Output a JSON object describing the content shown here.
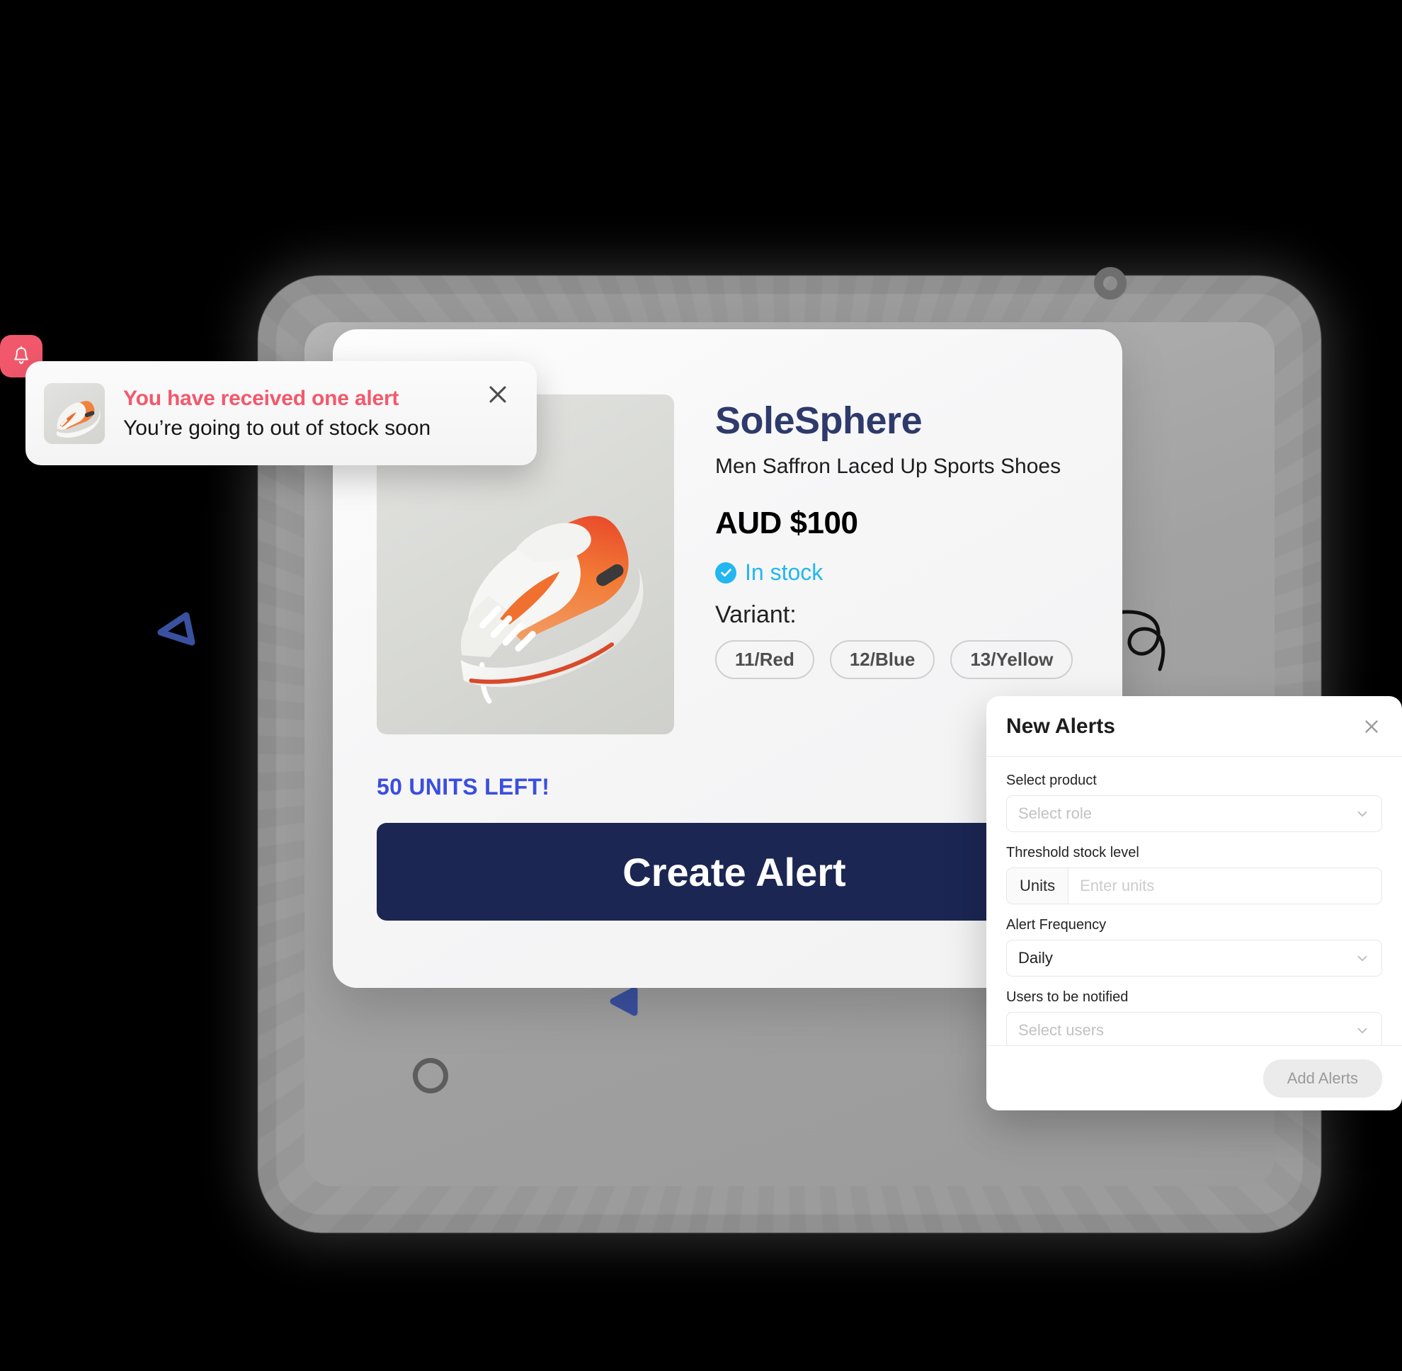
{
  "toast": {
    "bell_icon": "bell-icon",
    "title": "You have received one alert",
    "subtitle": "You’re going to out of stock soon",
    "close_icon": "close-icon",
    "thumb_icon": "product-thumbnail"
  },
  "product": {
    "brand": "SoleSphere",
    "subtitle": "Men Saffron Laced Up Sports Shoes",
    "price": "AUD $100",
    "stock_status": "In stock",
    "stock_icon": "check-circle-icon",
    "variant_label": "Variant:",
    "variants": [
      "11/Red",
      "12/Blue",
      "13/Yellow"
    ],
    "units_left": "50 UNITS LEFT!",
    "cta_label": "Create Alert",
    "image_icon": "sneaker-image"
  },
  "alerts_panel": {
    "title": "New Alerts",
    "close_icon": "close-icon",
    "fields": {
      "product": {
        "label": "Select product",
        "placeholder": "Select role",
        "value": ""
      },
      "threshold": {
        "label": "Threshold stock level",
        "prefix": "Units",
        "placeholder": "Enter units",
        "value": ""
      },
      "frequency": {
        "label": "Alert Frequency",
        "value": "Daily"
      },
      "users": {
        "label": "Users to be notified",
        "placeholder": "Select users",
        "value": ""
      }
    },
    "submit_label": "Add Alerts",
    "chevron_icon": "chevron-down-icon"
  },
  "decor": {
    "arrow_icon": "curly-arrow-icon",
    "triangle_outline_icon": "triangle-outline-icon",
    "triangle_filled_icon": "triangle-filled-icon",
    "ring_top_icon": "ring-icon",
    "ring_bottom_icon": "ring-icon"
  },
  "colors": {
    "brand_navy": "#2e3a6b",
    "cta_navy": "#1b2653",
    "alert_red": "#f2586c",
    "stock_cyan": "#22b7f0",
    "units_blue": "#3a4ee0",
    "decor_blue": "#3a51a0"
  }
}
